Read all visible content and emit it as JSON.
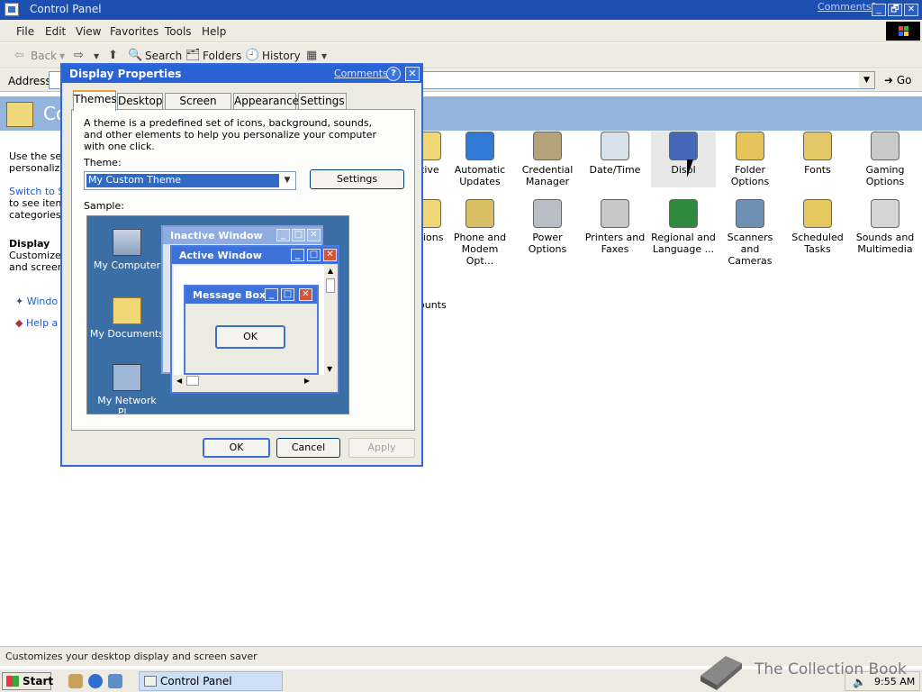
{
  "window": {
    "title": "Control Panel",
    "comments_link": "Comments?",
    "min_glyph": "_",
    "max_glyph": "🗗",
    "close_glyph": "✕"
  },
  "menubar": [
    "File",
    "Edit",
    "View",
    "Favorites",
    "Tools",
    "Help"
  ],
  "toolbar": {
    "back": "Back",
    "search": "Search",
    "folders": "Folders",
    "history": "History"
  },
  "address": {
    "label": "Address",
    "value": "",
    "go": "Go"
  },
  "banner": {
    "title": "Cont"
  },
  "leftpane": {
    "line1": "Use the set",
    "line2": "personalize",
    "switch_link": "Switch to Si",
    "line3": "to see items",
    "line4": "categories.",
    "section_title": "Display",
    "sec_line1": "Customizes",
    "sec_line2": "and screen",
    "link1": "Windo",
    "link2": "Help a"
  },
  "cp_items": [
    {
      "name": "ative",
      "icon": "folder-icon"
    },
    {
      "name": "Automatic Updates",
      "icon": "globe-update-icon"
    },
    {
      "name": "Credential Manager",
      "icon": "keys-icon"
    },
    {
      "name": "Date/Time",
      "icon": "calendar-clock-icon"
    },
    {
      "name": "Displ",
      "icon": "monitor-icon"
    },
    {
      "name": "Folder Options",
      "icon": "folder-tools-icon"
    },
    {
      "name": "Fonts",
      "icon": "fonts-folder-icon"
    },
    {
      "name": "Gaming Options",
      "icon": "joystick-icon"
    },
    {
      "name": "rk ions",
      "icon": "folder-icon"
    },
    {
      "name": "Phone and Modem Opt...",
      "icon": "phone-icon"
    },
    {
      "name": "Power Options",
      "icon": "battery-icon"
    },
    {
      "name": "Printers and Faxes",
      "icon": "printer-icon"
    },
    {
      "name": "Regional and Language ...",
      "icon": "globe-icon"
    },
    {
      "name": "Scanners and Cameras",
      "icon": "camera-icon"
    },
    {
      "name": "Scheduled Tasks",
      "icon": "tasks-folder-icon"
    },
    {
      "name": "Sounds and Multimedia",
      "icon": "speaker-icon"
    }
  ],
  "cp_extra": "ounts",
  "dialog": {
    "title": "Display Properties",
    "comments": "Comments?",
    "help": "?",
    "close": "✕",
    "tabs": [
      "Themes",
      "Desktop",
      "Screen Saver",
      "Appearance",
      "Settings"
    ],
    "active_tab": "Themes",
    "description": "A theme is a predefined set of icons, background, sounds, and other elements to help you personalize your computer with one click.",
    "theme_label": "Theme:",
    "theme_value": "My Custom Theme",
    "settings_button": "Settings",
    "sample_label": "Sample:",
    "sample": {
      "icons": [
        "My Computer",
        "My Documents",
        "My Network Pl..."
      ],
      "inactive_window": "Inactive Window",
      "active_window": "Active Window",
      "message_box": "Message Box",
      "ok": "OK"
    },
    "ok": "OK",
    "cancel": "Cancel",
    "apply": "Apply"
  },
  "statusbar": {
    "text": "Customizes your desktop display and screen saver"
  },
  "taskbar": {
    "start": "Start",
    "task": "Control Panel",
    "clock": "9:55 AM"
  },
  "watermark": {
    "text": "The Collection Book"
  },
  "colors": {
    "title_blue": "#1d4fb0",
    "dialog_blue": "#2a63d6",
    "highlight": "#316ac5",
    "desktop_sample": "#3a6ea5"
  }
}
